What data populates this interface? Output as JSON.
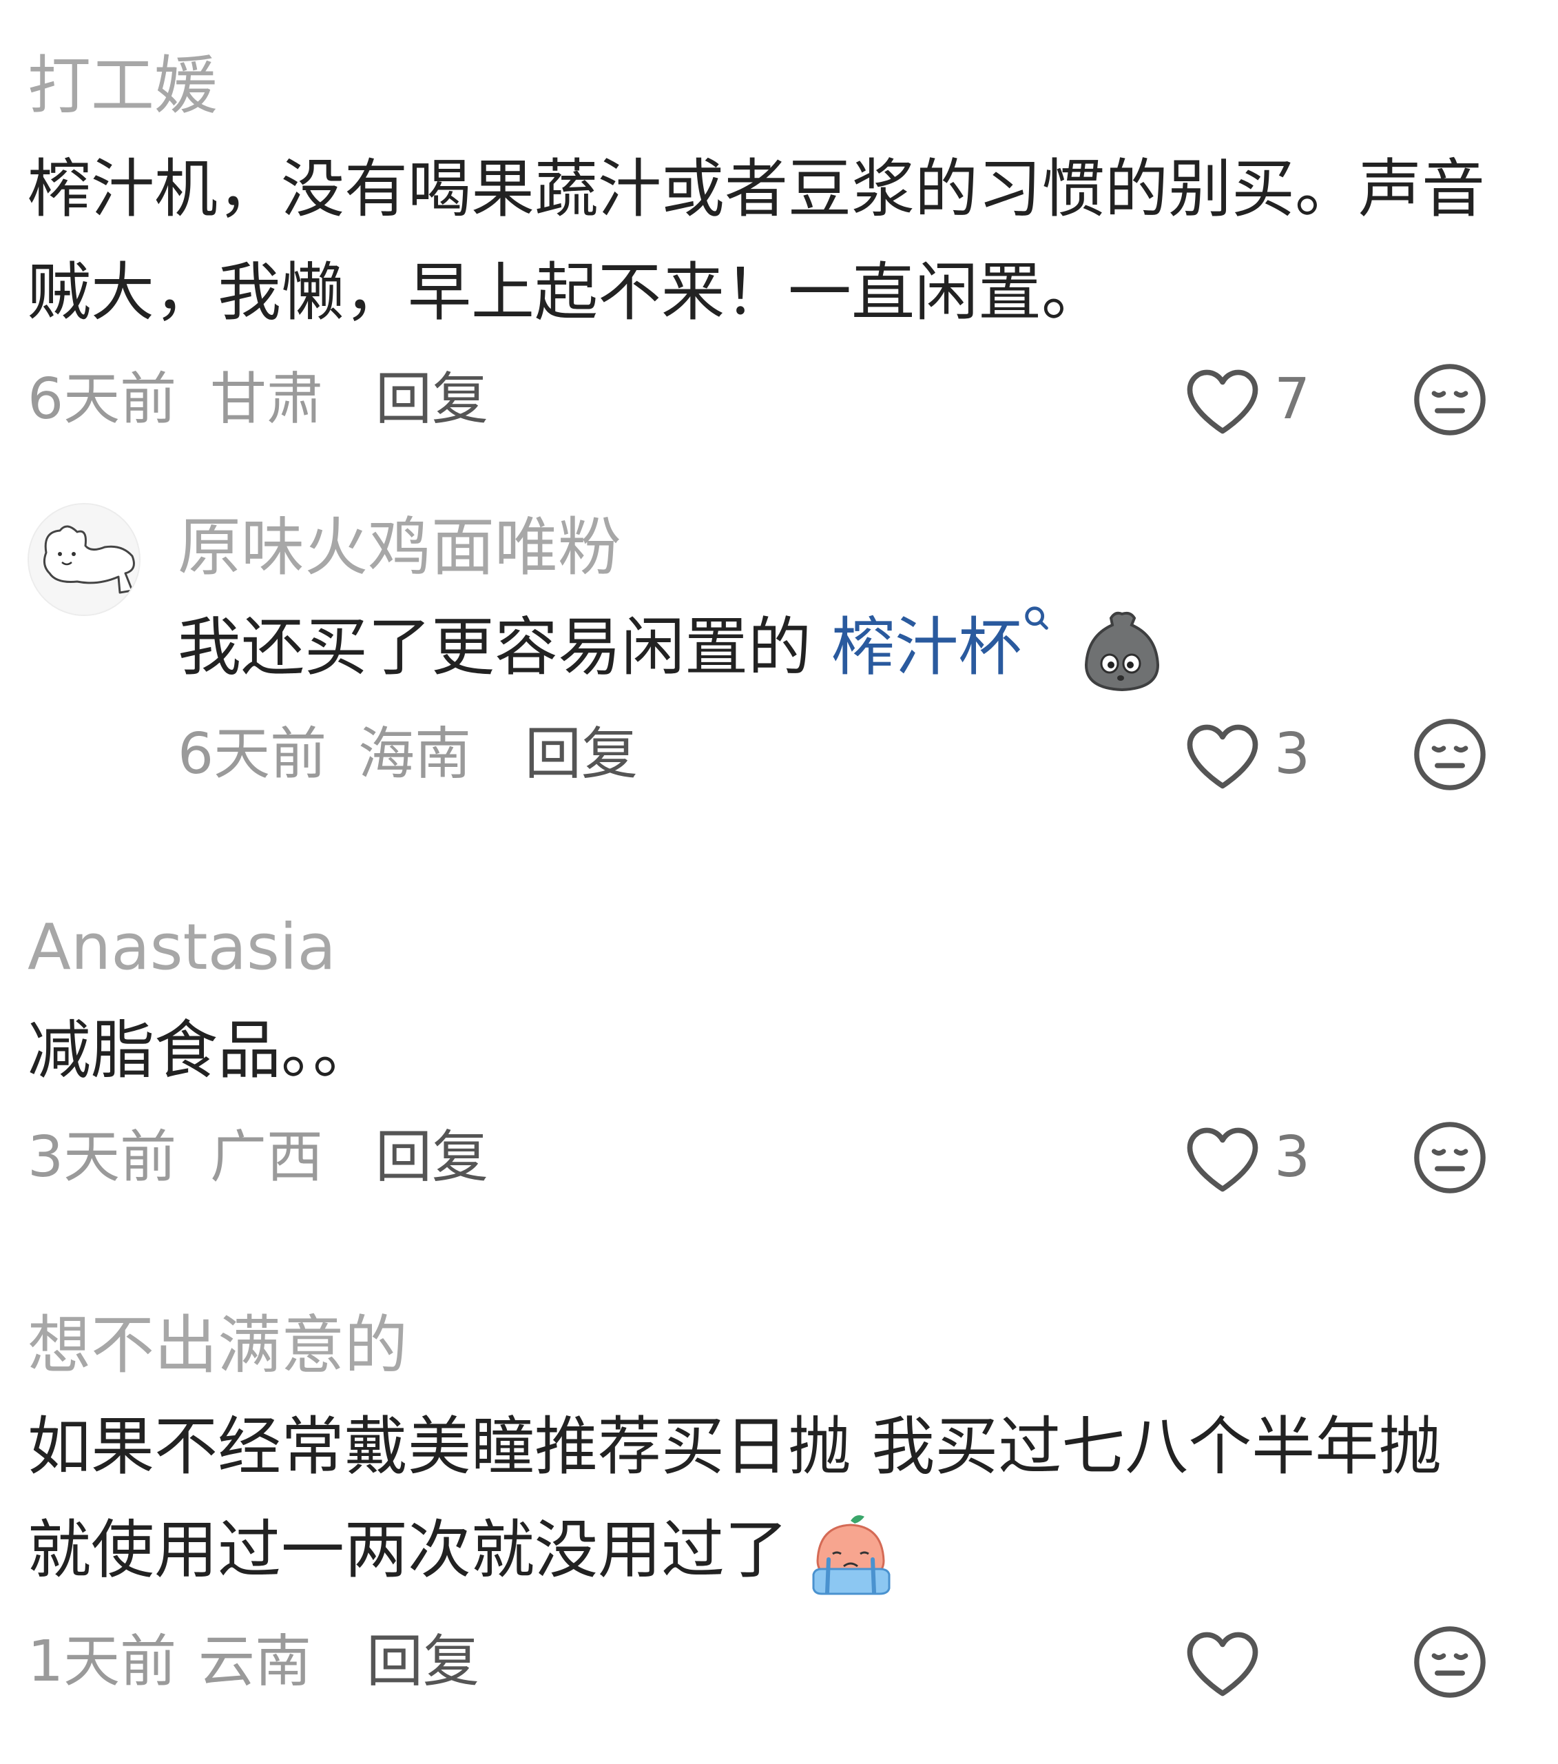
{
  "colors": {
    "username": "#a7a7a7",
    "body": "#222222",
    "meta": "#9a9a9a",
    "reply": "#555555",
    "link": "#2a5a9e",
    "icon": "#555555"
  },
  "comments": [
    {
      "username": "打工媛",
      "text": "榨汁机，没有喝果蔬汁或者豆浆的习惯的别买。声音贼大，我懒，早上起不来！一直闲置。",
      "time": "6天前",
      "location": "甘肃",
      "reply_label": "回复",
      "likes": "7",
      "like_icon": "heart-outline-icon",
      "dislike_icon": "meh-face-icon"
    },
    {
      "username": "原味火鸡面唯粉",
      "avatar_icon": "sketch-animal-avatar-icon",
      "text_before_link": "我还买了更容易闲置的 ",
      "link_text": "榨汁杯",
      "link_icon": "search-small-icon",
      "emoji": "grey-blob-emoji-icon",
      "time": "6天前",
      "location": "海南",
      "reply_label": "回复",
      "likes": "3",
      "like_icon": "heart-outline-icon",
      "dislike_icon": "meh-face-icon"
    },
    {
      "username": "Anastasia",
      "text": "减脂食品。。",
      "time": "3天前",
      "location": "广西",
      "reply_label": "回复",
      "likes": "3",
      "like_icon": "heart-outline-icon",
      "dislike_icon": "meh-face-icon"
    },
    {
      "username": "想不出满意的",
      "text": "如果不经常戴美瞳推荐买日抛 我买过七八个半年抛就使用过一两次就没用过了",
      "emoji": "crying-peach-emoji-icon",
      "time": "1天前",
      "location": "云南",
      "reply_label": "回复",
      "likes": "",
      "like_icon": "heart-outline-icon",
      "dislike_icon": "meh-face-icon"
    }
  ]
}
